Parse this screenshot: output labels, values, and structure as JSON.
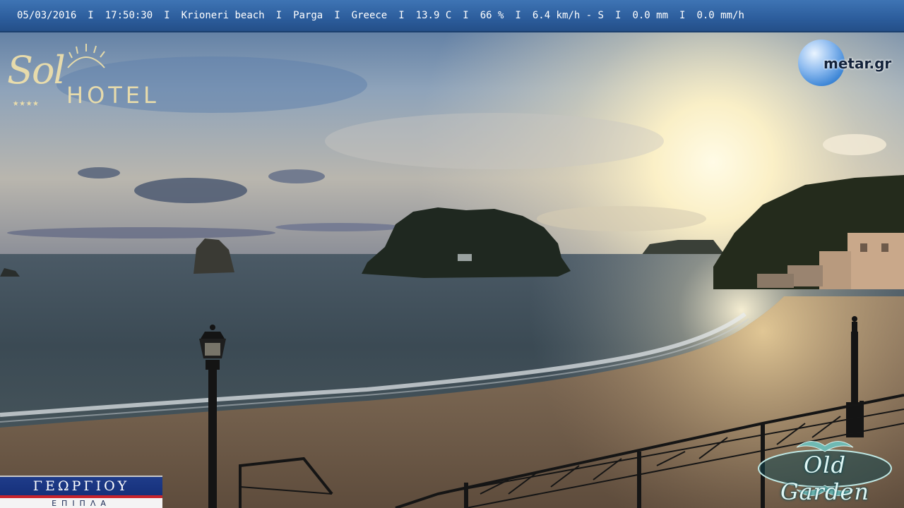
{
  "overlay": {
    "date": "05/03/2016",
    "time": "17:50:30",
    "place": "Krioneri beach",
    "town": "Parga",
    "country": "Greece",
    "temperature": "13.9 C",
    "humidity": "66 %",
    "wind": "6.4 km/h - S",
    "rain": "0.0 mm",
    "rain_rate": "0.0 mm/h",
    "separator": "I"
  },
  "logos": {
    "sol": {
      "word": "Sol",
      "hotel": "HOTEL",
      "stars": "★★★★"
    },
    "metar": {
      "text": "metar.gr"
    },
    "georgiou": {
      "name": "ΓΕΩΡΓΙΟΥ",
      "sub": "ΕΠΙΠΛΑ"
    },
    "garden": {
      "text": "Old Garden"
    }
  },
  "colors": {
    "overlay_bar": "#2c5d9c",
    "sky_top": "#4a6f9e",
    "sun_glow": "#fff3c8",
    "sea": "#3c4a52",
    "sand": "#8a7258"
  }
}
